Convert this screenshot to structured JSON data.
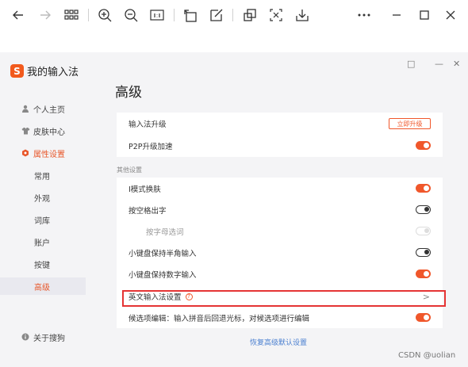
{
  "toolbar": {
    "icons": [
      "back-arrow",
      "forward-arrow",
      "grid",
      "zoom-in",
      "zoom-out",
      "actual-size",
      "rotate",
      "edit",
      "crop",
      "translate",
      "download",
      "more",
      "minimize",
      "maximize",
      "close"
    ]
  },
  "app": {
    "name": "我的输入法",
    "logo_letter": "S"
  },
  "sidebar": {
    "items": [
      {
        "label": "个人主页",
        "icon": "person-icon"
      },
      {
        "label": "皮肤中心",
        "icon": "shirt-icon"
      },
      {
        "label": "属性设置",
        "icon": "settings-icon",
        "active": true
      }
    ],
    "sub_items": [
      "常用",
      "外观",
      "词库",
      "账户",
      "按键",
      "高级"
    ],
    "active_sub": "高级",
    "about": "关于搜狗"
  },
  "window": {
    "controls": [
      "□",
      "—",
      "✕"
    ]
  },
  "page": {
    "title": "高级",
    "upgrade_row": "输入法升级",
    "upgrade_button": "立即升级",
    "p2p_row": "P2P升级加速",
    "section_other": "其他设置",
    "rows": [
      {
        "label": "I模式换肤",
        "toggle": "on"
      },
      {
        "label": "按空格出字",
        "toggle": "off"
      },
      {
        "label": "按字母选词",
        "toggle": "disabled",
        "dim": true
      },
      {
        "label": "小键盘保持半角输入",
        "toggle": "off"
      },
      {
        "label": "小键盘保持数字输入",
        "toggle": "on"
      },
      {
        "label": "英文输入法设置",
        "help": "?",
        "chevron": ">"
      },
      {
        "label": "候选项编辑：输入拼音后回退光标，对候选项进行编辑",
        "toggle": "on"
      }
    ],
    "reset_link": "恢复高级默认设置"
  },
  "watermark": "CSDN @uolian",
  "colors": {
    "accent": "#f0572b",
    "highlight": "#e53434",
    "link": "#4a7fd0"
  }
}
